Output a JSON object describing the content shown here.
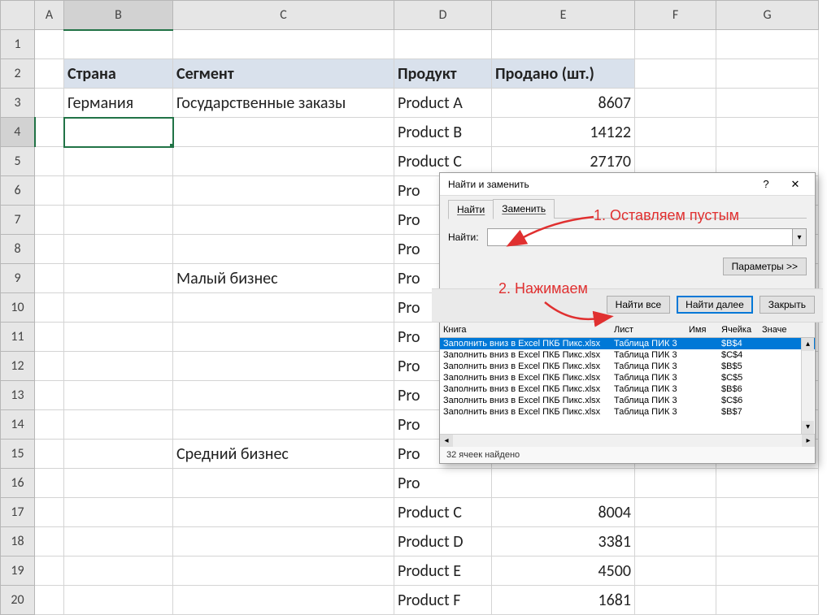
{
  "columns": [
    "A",
    "B",
    "C",
    "D",
    "E",
    "F",
    "G"
  ],
  "rows_count": 20,
  "active_col": "B",
  "active_row": 4,
  "header": {
    "B": "Страна",
    "C": "Сегмент",
    "D": "Продукт",
    "E": "Продано (шт.)"
  },
  "data": {
    "3": {
      "B": "Германия",
      "C": "Государственные заказы",
      "D": "Product A",
      "E": "8607"
    },
    "4": {
      "D": "Product B",
      "E": "14122"
    },
    "5": {
      "D": "Product C",
      "E": "27170"
    },
    "6": {
      "D": "Pro"
    },
    "7": {
      "D": "Pro"
    },
    "8": {
      "D": "Pro"
    },
    "9": {
      "C": "Малый бизнес",
      "D": "Pro"
    },
    "10": {
      "D": "Pro"
    },
    "11": {
      "D": "Pro"
    },
    "12": {
      "D": "Pro"
    },
    "13": {
      "D": "Pro"
    },
    "14": {
      "D": "Pro"
    },
    "15": {
      "C": "Средний бизнес",
      "D": "Pro"
    },
    "16": {
      "D": "Pro"
    },
    "17": {
      "D": "Product C",
      "E": "8004"
    },
    "18": {
      "D": "Product D",
      "E": "3381"
    },
    "19": {
      "D": "Product E",
      "E": "4500"
    },
    "20": {
      "D": "Product F",
      "E": "1681"
    }
  },
  "dialog": {
    "title": "Найти и заменить",
    "help": "?",
    "close": "✕",
    "tab_find": "Найти",
    "tab_replace": "Заменить",
    "find_label": "Найти:",
    "find_value": "",
    "options_btn": "Параметры >>",
    "find_all_btn": "Найти все",
    "find_next_btn": "Найти далее",
    "close_btn": "Закрыть",
    "cols": {
      "book": "Книга",
      "sheet": "Лист",
      "name": "Имя",
      "cell": "Ячейка",
      "value": "Значе"
    },
    "results": [
      {
        "book": "Заполнить вниз в Excel ПКБ Пикс.xlsx",
        "sheet": "Таблица ПИК 3",
        "name": "",
        "cell": "$B$4",
        "sel": true
      },
      {
        "book": "Заполнить вниз в Excel ПКБ Пикс.xlsx",
        "sheet": "Таблица ПИК 3",
        "name": "",
        "cell": "$C$4"
      },
      {
        "book": "Заполнить вниз в Excel ПКБ Пикс.xlsx",
        "sheet": "Таблица ПИК 3",
        "name": "",
        "cell": "$B$5"
      },
      {
        "book": "Заполнить вниз в Excel ПКБ Пикс.xlsx",
        "sheet": "Таблица ПИК 3",
        "name": "",
        "cell": "$C$5"
      },
      {
        "book": "Заполнить вниз в Excel ПКБ Пикс.xlsx",
        "sheet": "Таблица ПИК 3",
        "name": "",
        "cell": "$B$6"
      },
      {
        "book": "Заполнить вниз в Excel ПКБ Пикс.xlsx",
        "sheet": "Таблица ПИК 3",
        "name": "",
        "cell": "$C$6"
      },
      {
        "book": "Заполнить вниз в Excel ПКБ Пикс.xlsx",
        "sheet": "Таблица ПИК 3",
        "name": "",
        "cell": "$B$7"
      }
    ],
    "status": "32 ячеек найдено"
  },
  "annotations": {
    "a1": "1. Оставляем пустым",
    "a2": "2. Нажимаем"
  }
}
